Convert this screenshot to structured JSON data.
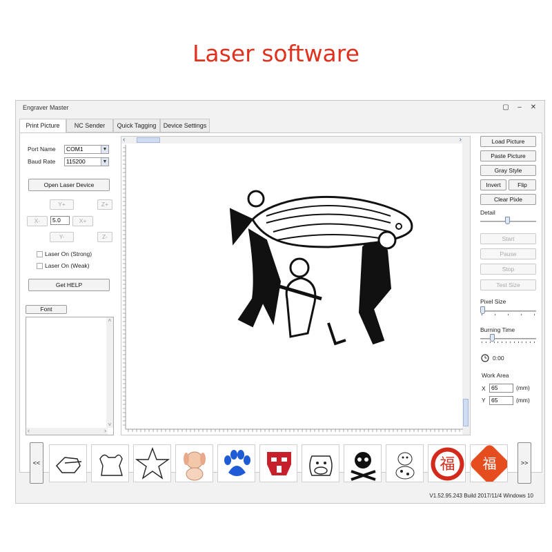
{
  "banner": {
    "text": "Laser software"
  },
  "window": {
    "title": "Engraver Master",
    "controls": {
      "minimize": "▢",
      "restore": "–",
      "close": "✕"
    }
  },
  "tabs": [
    {
      "label": "Print Picture",
      "active": true
    },
    {
      "label": "NC Sender"
    },
    {
      "label": "Quick Tagging"
    },
    {
      "label": "Device Settings"
    }
  ],
  "left": {
    "port_name_label": "Port Name",
    "port_name_value": "COM1",
    "baud_rate_label": "Baud Rate",
    "baud_rate_value": "115200",
    "open_device": "Open Laser Device",
    "jog": {
      "y_plus": "Y+",
      "z_plus": "Z+",
      "x_minus": "X-",
      "step": "5.0",
      "x_plus": "X+",
      "y_minus": "Y-",
      "z_minus": "Z-"
    },
    "laser_strong": "Laser On (Strong)",
    "laser_weak": "Laser On (Weak)",
    "get_help": "Get HELP",
    "font": "Font"
  },
  "right": {
    "load_picture": "Load Picture",
    "paste_picture": "Paste Picture",
    "gray_style": "Gray Style",
    "invert": "Invert",
    "flip": "Flip",
    "clear_pixel": "Clear Pixle",
    "detail_label": "Detail",
    "start": "Start",
    "pause": "Pause",
    "stop": "Stop",
    "test_size": "Test Size",
    "pixel_size_label": "Pixel Size",
    "burning_time_label": "Burning Time",
    "time_value": "0:00",
    "work_area_label": "Work Area",
    "x_label": "X",
    "x_value": "65",
    "y_label": "Y",
    "y_value": "65",
    "unit": "(mm)"
  },
  "scroll": {
    "left": "‹",
    "right": "›",
    "up": "˄",
    "down": "˅"
  },
  "thumbnails": {
    "prev": "<<",
    "next": ">>",
    "items": [
      "pointing-hand",
      "bull",
      "star-figure",
      "puppy",
      "paw-print",
      "robot-logo",
      "cow",
      "skull-crossbones",
      "dalmatian",
      "fu-seal-circle",
      "fu-seal-diamond"
    ],
    "seal_char": "福"
  },
  "version": "V1.52.95.243 Build 2017/11/4 Windows 10",
  "colors": {
    "banner": "#e0301e",
    "seal_red": "#d42a1c",
    "paw_blue": "#1f5bd6",
    "robot_red": "#c8202a"
  }
}
